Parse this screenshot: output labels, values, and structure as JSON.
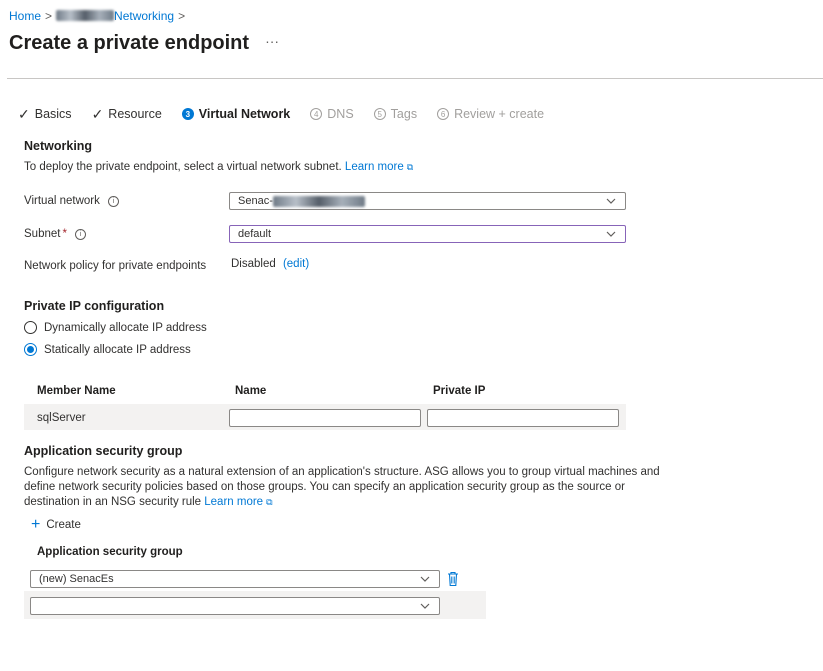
{
  "breadcrumb": {
    "home": "Home",
    "separator": ">",
    "networking": "Networking",
    "trailing_separator": ">"
  },
  "page": {
    "title": "Create a private endpoint",
    "more": "···"
  },
  "tabs": [
    {
      "label": "Basics",
      "state": "done",
      "marker": "✓"
    },
    {
      "label": "Resource",
      "state": "done",
      "marker": "✓"
    },
    {
      "label": "Virtual Network",
      "state": "active",
      "marker": "3"
    },
    {
      "label": "DNS",
      "state": "disabled",
      "marker": "4"
    },
    {
      "label": "Tags",
      "state": "disabled",
      "marker": "5"
    },
    {
      "label": "Review + create",
      "state": "disabled",
      "marker": "6"
    }
  ],
  "networking": {
    "heading": "Networking",
    "description": "To deploy the private endpoint, select a virtual network subnet.",
    "learn_more": "Learn more",
    "virtual_network_label": "Virtual network",
    "virtual_network_value": "Senac-",
    "subnet_label": "Subnet",
    "subnet_required": "*",
    "subnet_value": "default",
    "policy_label": "Network policy for private endpoints",
    "policy_value": "Disabled",
    "policy_edit": "(edit)"
  },
  "ip_config": {
    "heading": "Private IP configuration",
    "options": [
      "Dynamically allocate IP address",
      "Statically allocate IP address"
    ],
    "selected": "Statically allocate IP address",
    "table_headers": [
      "Member Name",
      "Name",
      "Private IP"
    ],
    "rows": [
      {
        "member": "sqlServer",
        "name": "",
        "ip": ""
      }
    ]
  },
  "asg": {
    "heading": "Application security group",
    "description_line1": "Configure network security as a natural extension of an application's structure. ASG allows you to group virtual machines and",
    "description_line2": "define network security policies based on those groups. You can specify an application security group as the source or",
    "description_line3": "destination in an NSG security rule",
    "learn_more": "Learn more",
    "create_label": "Create",
    "create_icon": "+",
    "column_header": "Application security group",
    "rows": [
      {
        "value": "(new) SenacEs"
      },
      {
        "value": ""
      }
    ]
  },
  "colors": {
    "accent": "#0078d4",
    "focus_border": "#8764b8",
    "row_bg": "#f3f2f1",
    "required": "#a4262c"
  }
}
